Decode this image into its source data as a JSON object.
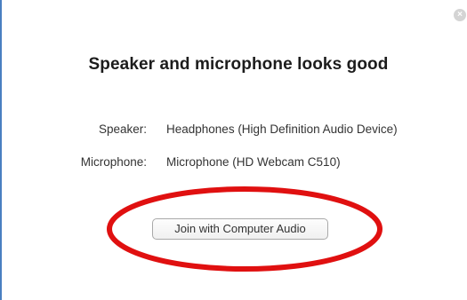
{
  "dialog": {
    "close_symbol": "×",
    "title": "Speaker and microphone looks good",
    "speaker": {
      "label": "Speaker:",
      "value": "Headphones (High Definition Audio Device)"
    },
    "microphone": {
      "label": "Microphone:",
      "value": "Microphone (HD Webcam C510)"
    },
    "join_button_label": "Join with Computer Audio"
  },
  "annotation": {
    "color": "#e01010",
    "shape": "ellipse"
  },
  "colors": {
    "frame_accent": "#4a7fc1",
    "title_text": "#1c1c1c",
    "body_text": "#333333"
  },
  "icons": {
    "close": "close-icon"
  }
}
